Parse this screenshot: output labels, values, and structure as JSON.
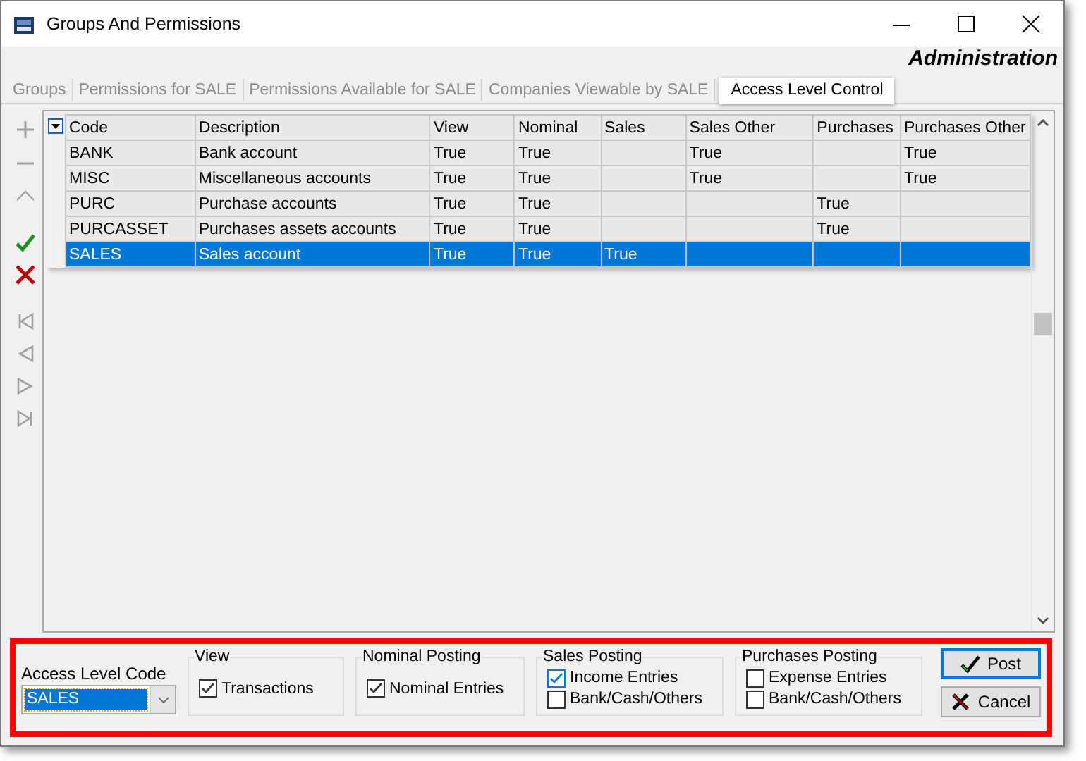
{
  "window": {
    "title": "Groups And Permissions"
  },
  "header": "Administration",
  "tabs": [
    {
      "label": "Groups",
      "selected": false
    },
    {
      "label": "Permissions for SALE",
      "selected": false
    },
    {
      "label": "Permissions Available for SALE",
      "selected": false
    },
    {
      "label": "Companies Viewable by SALE",
      "selected": false
    },
    {
      "label": "Access Level Control",
      "selected": true
    }
  ],
  "navigator": [
    {
      "kind": "add",
      "disabled": true
    },
    {
      "kind": "remove",
      "disabled": true
    },
    {
      "kind": "edit",
      "disabled": true
    },
    {
      "kind": "confirm",
      "disabled": false
    },
    {
      "kind": "cancel",
      "disabled": false
    },
    {
      "kind": "first",
      "disabled": true
    },
    {
      "kind": "prior",
      "disabled": true
    },
    {
      "kind": "next",
      "disabled": true
    },
    {
      "kind": "last",
      "disabled": true
    }
  ],
  "grid": {
    "columns": [
      "Code",
      "Description",
      "View",
      "Nominal",
      "Sales",
      "Sales Other",
      "Purchases",
      "Purchases Other"
    ],
    "rows": [
      {
        "cells": [
          "BANK",
          "Bank account",
          "True",
          "True",
          "",
          "True",
          "",
          "True"
        ],
        "selected": false
      },
      {
        "cells": [
          "MISC",
          "Miscellaneous accounts",
          "True",
          "True",
          "",
          "True",
          "",
          "True"
        ],
        "selected": false
      },
      {
        "cells": [
          "PURC",
          "Purchase accounts",
          "True",
          "True",
          "",
          "",
          "True",
          ""
        ],
        "selected": false
      },
      {
        "cells": [
          "PURCASSET",
          "Purchases assets accounts",
          "True",
          "True",
          "",
          "",
          "True",
          ""
        ],
        "selected": false
      },
      {
        "cells": [
          "SALES",
          "Sales account",
          "True",
          "True",
          "True",
          "",
          "",
          ""
        ],
        "selected": true
      }
    ]
  },
  "access_level_code": {
    "label": "Access Level Code",
    "value": "SALES"
  },
  "groups": [
    {
      "title": "View",
      "options": [
        {
          "label": "Transactions",
          "checked": true
        }
      ]
    },
    {
      "title": "Nominal Posting",
      "options": [
        {
          "label": "Nominal Entries",
          "checked": true
        }
      ]
    },
    {
      "title": "Sales Posting",
      "options": [
        {
          "label": "Income Entries",
          "checked": true
        },
        {
          "label": "Bank/Cash/Others",
          "checked": false
        }
      ]
    },
    {
      "title": "Purchases Posting",
      "options": [
        {
          "label": "Expense Entries",
          "checked": false
        },
        {
          "label": "Bank/Cash/Others",
          "checked": false
        }
      ]
    }
  ],
  "buttons": [
    {
      "kind": "post",
      "label": "Post",
      "default": true
    },
    {
      "kind": "cancel",
      "label": "Cancel",
      "default": false
    }
  ]
}
